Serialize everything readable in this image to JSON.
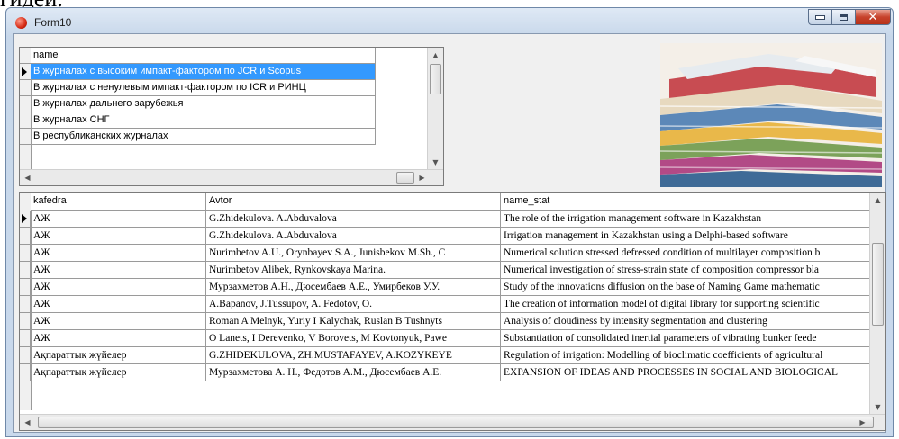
{
  "top_text": "гидей.",
  "window": {
    "title": "Form10"
  },
  "top_grid": {
    "header": "name",
    "rows": [
      "В журналах с высоким импакт-фактором по  JCR и Scopus",
      "В журналах с ненулевым импакт-фактором по ICR и РИНЦ",
      "В журналах дальнего зарубежья",
      "В журналах СНГ",
      "В республиканских журналах"
    ],
    "selected_index": 0
  },
  "bottom_grid": {
    "columns": [
      "kafedra",
      "Avtor",
      "name_stat"
    ],
    "rows": [
      [
        "АЖ",
        "G.Zhidekulova. A.Abduvalova",
        "The role of the irrigation management software in Kazakhstan"
      ],
      [
        "АЖ",
        "G.Zhidekulova. A.Abduvalova",
        "Irrigation management in Kazakhstan using a Delphi-based software"
      ],
      [
        "АЖ",
        "Nurimbetov A.U., Orynbayev S.A., Junisbekov M.Sh., C",
        "Numerical solution stressed defressed condition of multilayer composition b"
      ],
      [
        "АЖ",
        "Nurimbetov Alibek, Rynkovskaya Marina.",
        "Numerical investigation of stress-strain state of composition compressor bla"
      ],
      [
        "АЖ",
        "Мурзахметов А.Н., Дюсембаев А.Е., Умирбеков У.У.",
        "Study of the innovations diffusion on the base of Naming Game mathematic"
      ],
      [
        "АЖ",
        "A.Bapanov, J.Tussupov,  A. Fedotov, O.",
        "The creation of information model of digital library for supporting scientific"
      ],
      [
        "АЖ",
        "Roman A Melnyk, Yuriy I Kalychak, Ruslan B Tushnyts",
        "Analysis of cloudiness by intensity segmentation and clustering"
      ],
      [
        "АЖ",
        "O Lanets, I Derevenko, V Borovets, M Kovtonyuk, Pawe",
        "Substantiation of consolidated inertial parameters of vibrating bunker feede"
      ],
      [
        "Ақпараттық жүйелер",
        "G.ZHIDEKULOVA, ZH.MUSTAFAYEV, A.KOZYKEYE",
        "Regulation of irrigation: Modelling of bioclimatic coefficients of agricultural"
      ],
      [
        "Ақпараттық жүйелер",
        "Мурзахметова А. Н., Федотов А.М., Дюсембаев А.Е.",
        "EXPANSION OF IDEAS AND PROCESSES IN SOCIAL AND BIOLOGICAL"
      ]
    ],
    "current_row": 0
  },
  "icons": {
    "app": "app-icon",
    "minimize": "minimize-icon",
    "maximize": "maximize-icon",
    "close": "close-icon"
  },
  "colors": {
    "selection": "#3399ff",
    "close_button": "#c7422c"
  }
}
